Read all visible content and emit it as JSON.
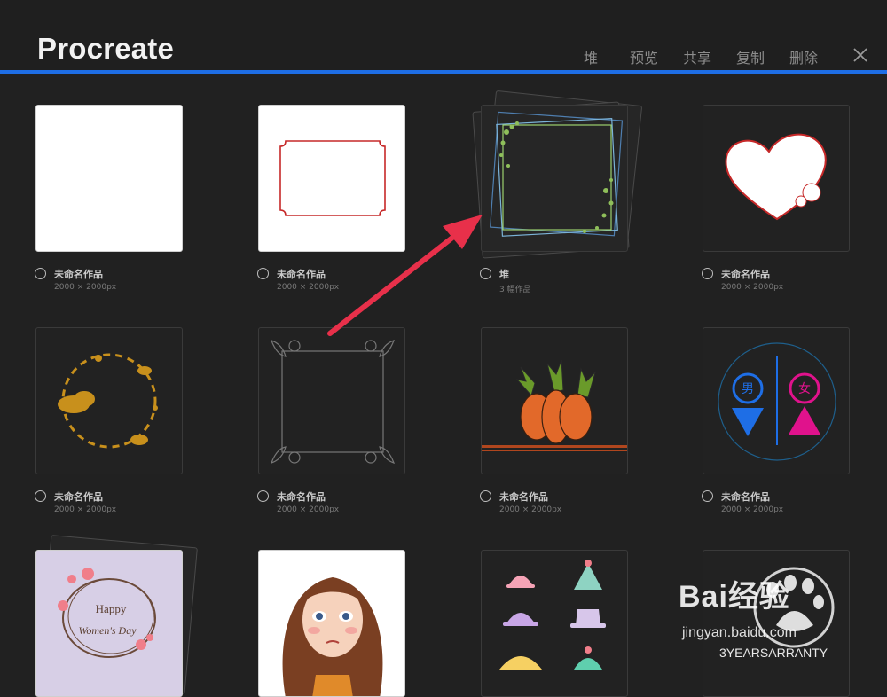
{
  "header": {
    "title": "Procreate",
    "actions": [
      "堆",
      "预览",
      "共享",
      "复制",
      "删除"
    ],
    "accent_color": "#1e6ee6"
  },
  "gallery": {
    "items": [
      {
        "title": "未命名作品",
        "subtitle": "2000 × 2000px"
      },
      {
        "title": "未命名作品",
        "subtitle": "2000 × 2000px"
      },
      {
        "title": "堆",
        "subtitle": "3 幅作品"
      },
      {
        "title": "未命名作品",
        "subtitle": "2000 × 2000px"
      },
      {
        "title": "未命名作品",
        "subtitle": "2000 × 2000px"
      },
      {
        "title": "未命名作品",
        "subtitle": "2000 × 2000px"
      },
      {
        "title": "未命名作品",
        "subtitle": "2000 × 2000px"
      },
      {
        "title": "未命名作品",
        "subtitle": "2000 × 2000px"
      }
    ],
    "thumb_text": {
      "happy": "Happy",
      "womens_day": "Women's Day",
      "male": "男",
      "female": "女"
    }
  },
  "annotation": {
    "arrow_color": "#e8304a"
  },
  "watermark": {
    "logo": "Bai经验",
    "url": "jingyan.baidu.com",
    "badge": "3YEARSARRANTY"
  }
}
